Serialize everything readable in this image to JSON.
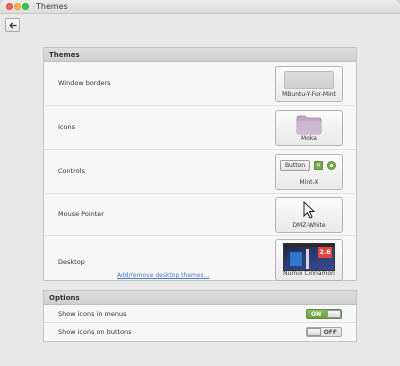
{
  "window": {
    "title": "Themes"
  },
  "themes_section": {
    "header": "Themes",
    "rows": [
      {
        "label": "Window borders",
        "value": "MBuntu-Y-For-Mint"
      },
      {
        "label": "Icons",
        "value": "Moka"
      },
      {
        "label": "Controls",
        "value": "Mint-X",
        "preview_button": "Button"
      },
      {
        "label": "Mouse Pointer",
        "value": "DMZ-White"
      },
      {
        "label": "Desktop",
        "value": "Numix Cinnamon",
        "preview_badge": "2.6",
        "link": "Add/remove desktop themes..."
      }
    ]
  },
  "options_section": {
    "header": "Options",
    "rows": [
      {
        "label": "Show icons in menus",
        "toggle": "ON"
      },
      {
        "label": "Show icons on buttons",
        "toggle": "OFF"
      }
    ]
  },
  "colors": {
    "accent_on": "#7aa84f",
    "link": "#4a78c8",
    "badge": "#e0433f"
  }
}
